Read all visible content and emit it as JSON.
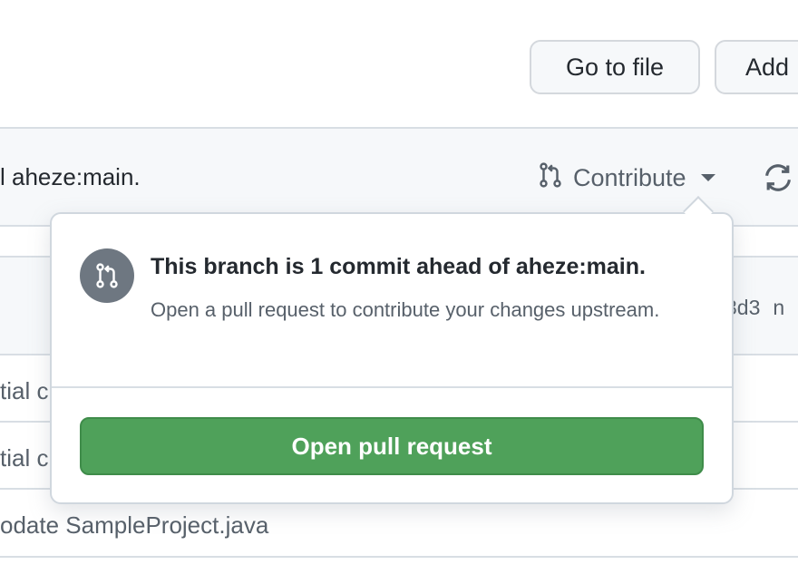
{
  "toolbar": {
    "go_to_file": "Go to file",
    "add_file": "Add"
  },
  "banner": {
    "text": "l aheze:main.",
    "contribute_label": "Contribute"
  },
  "list": {
    "row1_sha": "3d3",
    "row1_extra": "n",
    "row2_text": "tial c",
    "row3_text": "tial c",
    "row4_text": "odate SampleProject.java"
  },
  "popover": {
    "title": "This branch is 1 commit ahead of aheze:main.",
    "description": "Open a pull request to contribute your changes upstream.",
    "button_label": "Open pull request"
  },
  "colors": {
    "primary_button": "#4fa15a",
    "icon_badge": "#6e7781",
    "muted_text": "#57606a"
  },
  "icons": [
    "git-pull-request-icon",
    "chevron-down-icon",
    "sync-icon"
  ]
}
